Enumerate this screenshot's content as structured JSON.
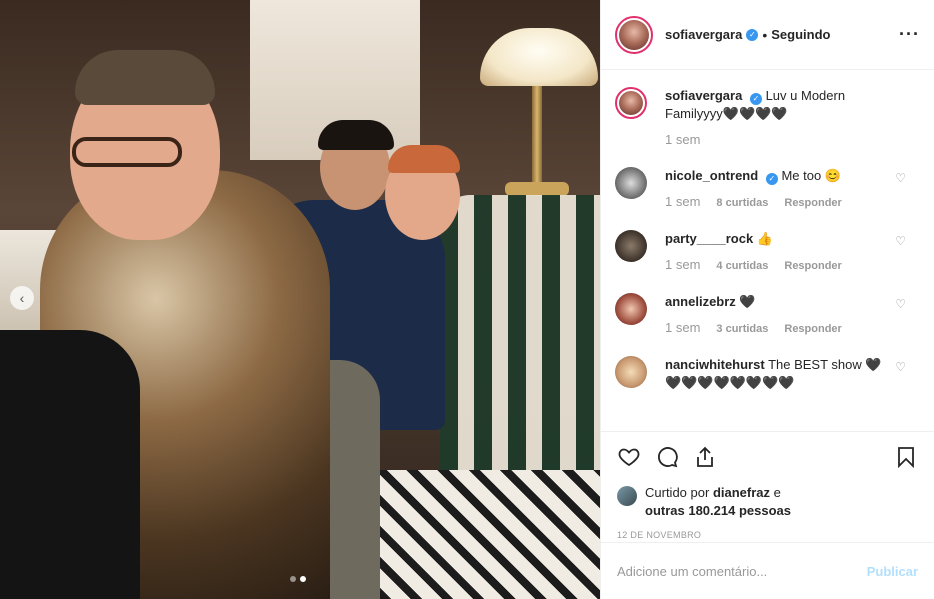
{
  "post": {
    "username": "sofiavergara",
    "follow_status": "Seguindo",
    "more_icon": "ellipsis-icon"
  },
  "caption": {
    "username": "sofiavergara",
    "text": "Luv u Modern Familyyyy🖤🖤🖤🖤",
    "time": "1 sem"
  },
  "comments": [
    {
      "username": "nicole_ontrend",
      "verified": true,
      "text": "Me too 😊",
      "time": "1 sem",
      "likes": "8 curtidas",
      "reply": "Responder"
    },
    {
      "username": "party____rock",
      "verified": false,
      "text": "👍",
      "time": "1 sem",
      "likes": "4 curtidas",
      "reply": "Responder"
    },
    {
      "username": "annelizebrz",
      "verified": false,
      "text": "🖤",
      "time": "1 sem",
      "likes": "3 curtidas",
      "reply": "Responder"
    },
    {
      "username": "nanciwhitehurst",
      "verified": false,
      "text": "The BEST show 🖤🖤🖤🖤🖤🖤🖤🖤🖤",
      "time": "",
      "likes": "",
      "reply": ""
    }
  ],
  "likes": {
    "prefix": "Curtido por",
    "liker": "dianefraz",
    "middle": "e",
    "others": "outras 180.214 pessoas"
  },
  "date": "12 DE NOVEMBRO",
  "add_comment": {
    "placeholder": "Adicione um comentário...",
    "publish": "Publicar"
  },
  "colors": {
    "accent": "#3897f0",
    "publish_disabled": "#b2dffc",
    "ring": "#e1306c"
  }
}
